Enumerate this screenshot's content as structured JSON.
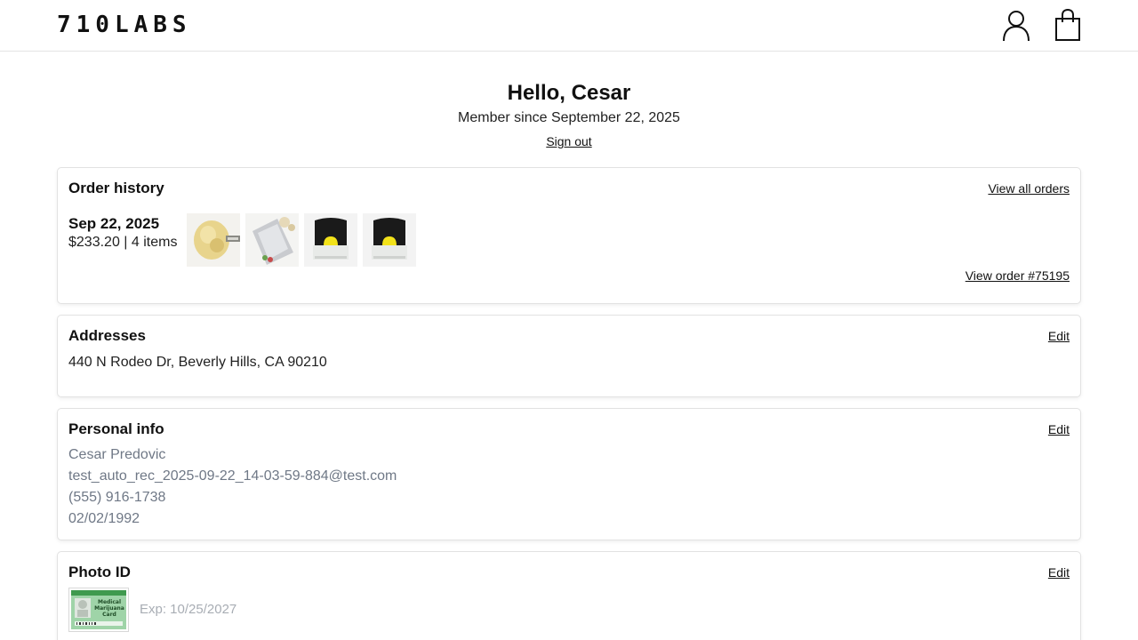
{
  "header": {
    "logo": "710LABS",
    "account_icon": "user-icon",
    "bag_icon": "shopping-bag-icon"
  },
  "profile": {
    "greeting": "Hello, Cesar",
    "member_since": "Member since September 22, 2025",
    "sign_out": "Sign out"
  },
  "order_history": {
    "title": "Order history",
    "view_all": "View all orders",
    "order": {
      "date": "Sep 22, 2025",
      "summary": "$233.20 | 4 items",
      "view_order": "View order #75195",
      "thumbnails": [
        "rosin-jar-thumbnail",
        "pouch-thumbnail",
        "vape-pod-thumbnail",
        "vape-pod-thumbnail"
      ]
    }
  },
  "addresses": {
    "title": "Addresses",
    "edit": "Edit",
    "address": "440 N Rodeo Dr, Beverly Hills, CA 90210"
  },
  "personal_info": {
    "title": "Personal info",
    "edit": "Edit",
    "name": "Cesar Predovic",
    "email": "test_auto_rec_2025-09-22_14-03-59-884@test.com",
    "phone": "(555) 916-1738",
    "dob": "02/02/1992"
  },
  "photo_id": {
    "title": "Photo ID",
    "edit": "Edit",
    "expiry": "Exp: 10/25/2027",
    "card_text": [
      "Medical",
      "Marijuana",
      "Card"
    ]
  },
  "colors": {
    "text": "#111111",
    "muted": "#6f7886",
    "border": "#e2e2e2",
    "pod_yellow": "#f2e21a",
    "id_green": "#3f9a4e"
  }
}
